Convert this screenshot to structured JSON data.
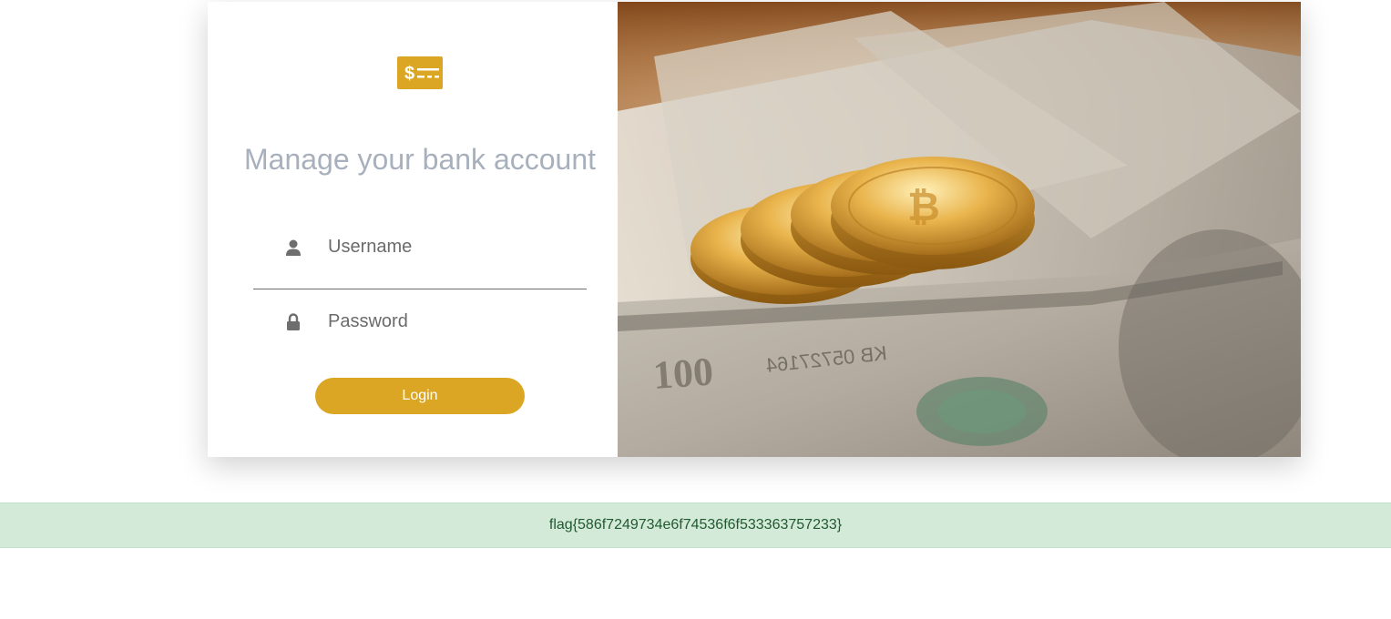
{
  "login_form": {
    "title": "Manage your bank account",
    "logo_icon": "money-check-dollar-icon",
    "username_icon": "user-icon",
    "password_icon": "lock-icon",
    "username_placeholder": "Username",
    "password_placeholder": "Password",
    "login_label": "Login"
  },
  "hero_image": {
    "subject": "gold coins on dollar bills"
  },
  "alert": {
    "text": "flag{586f7249734e6f74536f6f533363757233}"
  },
  "colors": {
    "accent": "#dba623",
    "title": "#a7b0bc",
    "alert_bg": "#d4ead9",
    "alert_text": "#1f5a2e"
  }
}
